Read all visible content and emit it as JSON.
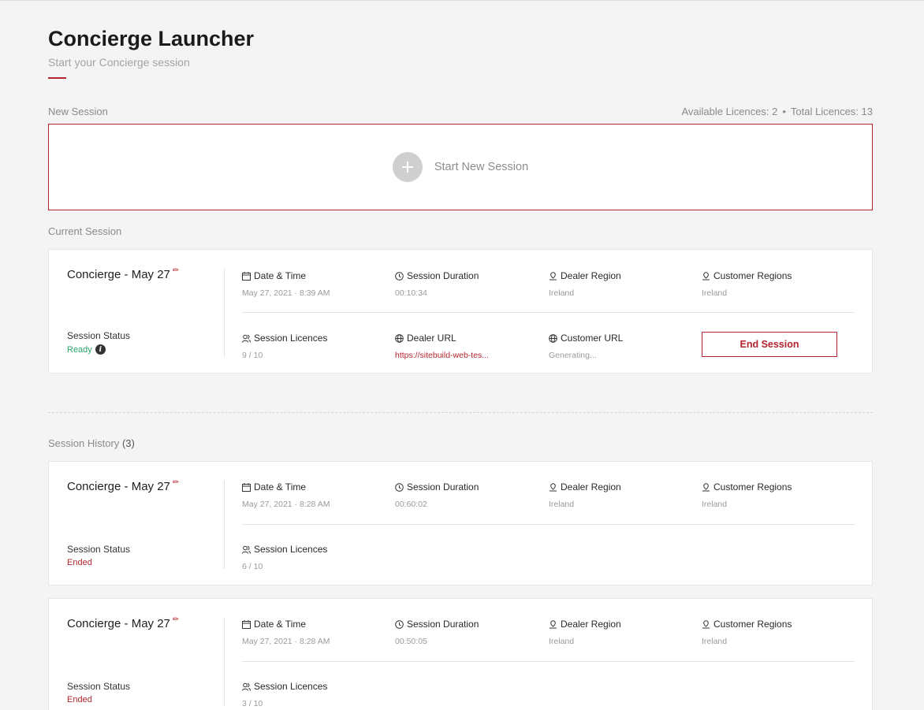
{
  "header": {
    "title": "Concierge Launcher",
    "subtitle": "Start your Concierge session"
  },
  "new_session": {
    "section_label": "New Session",
    "available_licences": "Available Licences: 2",
    "separator": "•",
    "total_licences": "Total Licences: 13",
    "start_label": "Start New Session"
  },
  "current_session": {
    "section_label": "Current Session",
    "name": "Concierge - May 27",
    "status_label": "Session Status",
    "status_value": "Ready",
    "date_label": "Date & Time",
    "date_value": "May 27, 2021 · 8:39 AM",
    "duration_label": "Session Duration",
    "duration_value": "00:10:34",
    "dealer_region_label": "Dealer Region",
    "dealer_region_value": "Ireland",
    "customer_regions_label": "Customer Regions",
    "customer_regions_value": "Ireland",
    "licences_label": "Session Licences",
    "licences_value": "9 / 10",
    "dealer_url_label": "Dealer URL",
    "dealer_url_value": "https://sitebuild-web-tes...",
    "customer_url_label": "Customer URL",
    "customer_url_value": "Generating...",
    "end_button": "End Session"
  },
  "history": {
    "section_label": "Session History",
    "count": "(3)",
    "items": [
      {
        "name": "Concierge - May 27",
        "status_label": "Session Status",
        "status_value": "Ended",
        "date_label": "Date & Time",
        "date_value": "May 27, 2021 · 8:28 AM",
        "duration_label": "Session Duration",
        "duration_value": "00:60:02",
        "dealer_region_label": "Dealer Region",
        "dealer_region_value": "Ireland",
        "customer_regions_label": "Customer Regions",
        "customer_regions_value": "Ireland",
        "licences_label": "Session Licences",
        "licences_value": "6 / 10"
      },
      {
        "name": "Concierge - May 27",
        "status_label": "Session Status",
        "status_value": "Ended",
        "date_label": "Date & Time",
        "date_value": "May 27, 2021 · 8:28 AM",
        "duration_label": "Session Duration",
        "duration_value": "00:50:05",
        "dealer_region_label": "Dealer Region",
        "dealer_region_value": "Ireland",
        "customer_regions_label": "Customer Regions",
        "customer_regions_value": "Ireland",
        "licences_label": "Session Licences",
        "licences_value": "3 / 10"
      }
    ]
  },
  "colors": {
    "accent": "#b4242e",
    "ready": "#2aa36b",
    "background": "#f4f4f4"
  },
  "icons": {
    "edit": "pencil-icon",
    "date": "calendar-icon",
    "duration": "clock-icon",
    "region": "location-pin-icon",
    "licences": "users-icon",
    "url": "globe-icon",
    "info": "info-icon",
    "add": "plus-icon"
  }
}
